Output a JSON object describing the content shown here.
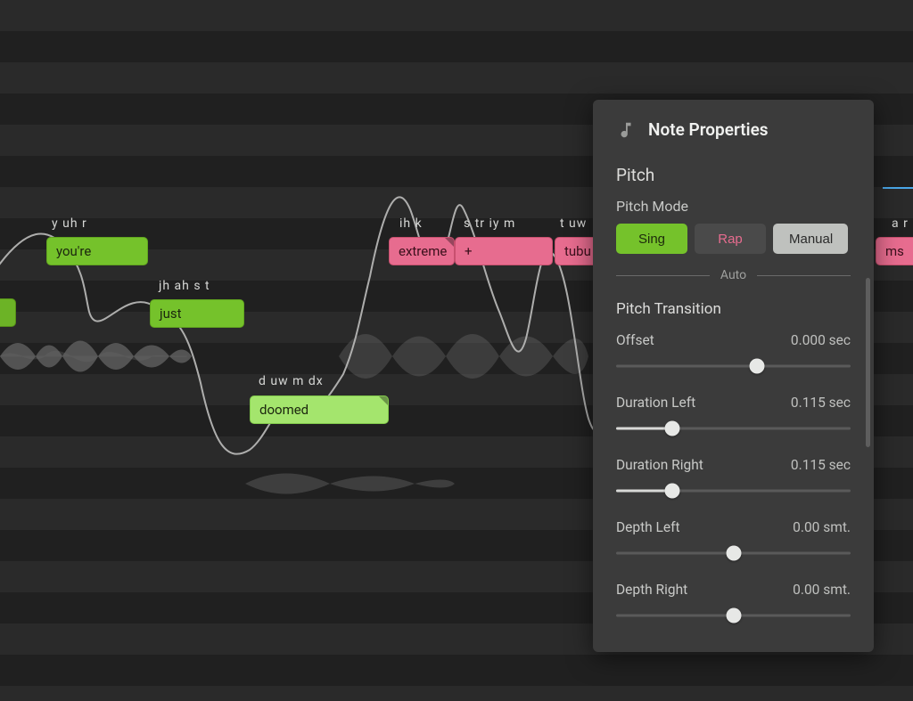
{
  "panel": {
    "title": "Note Properties",
    "section_pitch": "Pitch",
    "pitch_mode_label": "Pitch Mode",
    "modes": {
      "sing": "Sing",
      "rap": "Rap",
      "manual": "Manual"
    },
    "auto_label": "Auto",
    "transition_label": "Pitch Transition",
    "sliders": {
      "offset": {
        "label": "Offset",
        "value": "0.000 sec",
        "pos": 0.6,
        "fill": 0
      },
      "dur_left": {
        "label": "Duration Left",
        "value": "0.115 sec",
        "pos": 0.24,
        "fill": 0.24
      },
      "dur_right": {
        "label": "Duration Right",
        "value": "0.115 sec",
        "pos": 0.24,
        "fill": 0.24
      },
      "depth_left": {
        "label": "Depth Left",
        "value": "0.00 smt.",
        "pos": 0.5,
        "fill": 0
      },
      "depth_right": {
        "label": "Depth Right",
        "value": "0.00 smt.",
        "pos": 0.5,
        "fill": 0
      }
    }
  },
  "notes": {
    "youre": {
      "lyric": "you're",
      "phoneme": "y uh r"
    },
    "just": {
      "lyric": "just",
      "phoneme": "jh ah s t"
    },
    "doomed": {
      "lyric": "doomed",
      "phoneme": "d uw m dx"
    },
    "extreme": {
      "lyric": "extreme",
      "phoneme": "ih k"
    },
    "plus": {
      "lyric": "+",
      "phoneme": "s tr iy m"
    },
    "tubu": {
      "lyric": "tubu",
      "phoneme": "t uw"
    },
    "ms": {
      "lyric": "ms",
      "phoneme": "a r m"
    },
    "blank": {
      "lyric": "",
      "phoneme": ""
    }
  }
}
